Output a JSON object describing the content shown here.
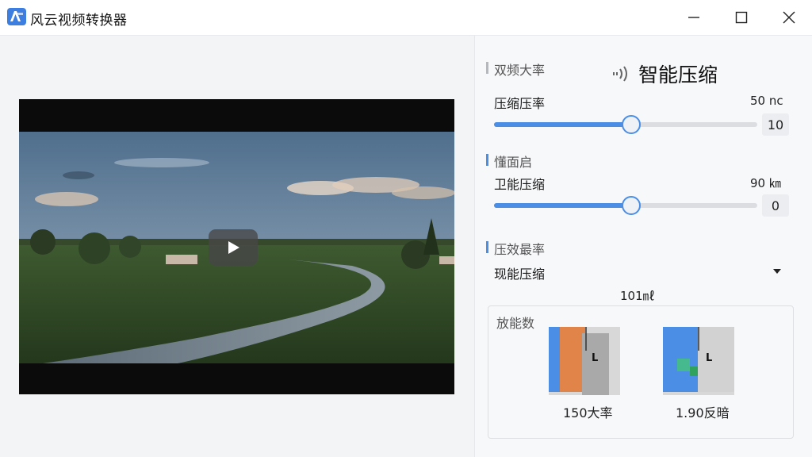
{
  "window": {
    "title": "风云视频转换器",
    "controls": [
      "minimize",
      "maximize",
      "close"
    ]
  },
  "player": {
    "play_icon": "play-icon"
  },
  "panel": {
    "section1_label": "双频大率",
    "feature_title": "智能压缩",
    "feature_icon": "signal-waves-icon",
    "row1": {
      "label": "压缩压率",
      "value_text": "50 nc",
      "slider_value": 0.52,
      "input_value": "10"
    },
    "section2_label": "懂面启",
    "row2": {
      "label": "卫能压缩",
      "value_text": "90 ㎞",
      "slider_value": 0.52,
      "input_value": "0"
    },
    "section3_label": "压效最率",
    "dropdown": {
      "value": "现能压缩"
    },
    "center_text": "101㎖",
    "params": {
      "label": "放能数",
      "cards": [
        {
          "badge": "L",
          "caption": "150大率"
        },
        {
          "badge": "L",
          "caption": "1.90反暗"
        }
      ]
    }
  },
  "colors": {
    "accent": "#4a8ee6",
    "orange": "#e0844a",
    "green": "#3cb56a"
  }
}
